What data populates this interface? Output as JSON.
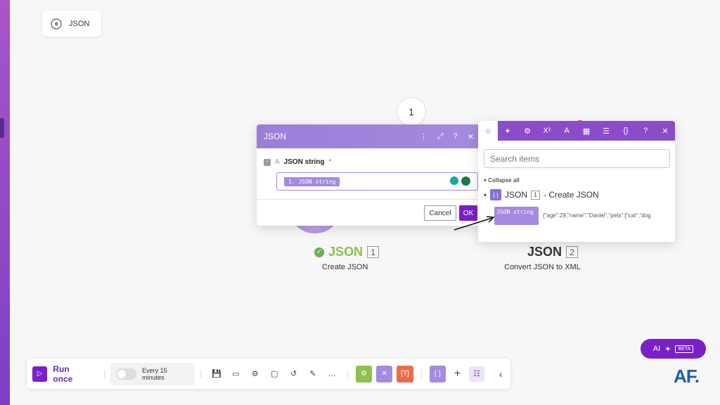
{
  "back": {
    "label": "JSON"
  },
  "route": {
    "number": "1"
  },
  "modules": [
    {
      "title": "JSON",
      "number": "1",
      "subtitle": "Create JSON",
      "color": "#8cc152"
    },
    {
      "title": "JSON",
      "number": "2",
      "subtitle": "Convert JSON to XML"
    }
  ],
  "json_panel": {
    "title": "JSON",
    "field_label": "JSON string",
    "required_mark": "*",
    "field_value": "1. JSON string",
    "cancel_label": "Cancel",
    "ok_label": "OK"
  },
  "map_panel": {
    "tabs": [
      "star-icon",
      "sparkle-icon",
      "gear-icon",
      "superscript-icon",
      "text-icon",
      "calendar-icon",
      "table-icon",
      "braces-icon",
      "help-icon",
      "close-icon"
    ],
    "search_placeholder": "Search items",
    "collapse_label": "Collapse all",
    "tree_module": "JSON",
    "tree_number": "1",
    "tree_suffix": "- Create JSON",
    "item_label": "JSON string",
    "item_value": "{\"age\":29,\"name\":\"Daniel\",\"pets\":[\"cat\",\"dog"
  },
  "toolbar": {
    "run_label": "Run once",
    "schedule_label": "Every 15 minutes"
  },
  "ai": {
    "label": "AI",
    "badge": "BETA"
  },
  "logo": "AF.",
  "colors": {
    "accent": "#7b1fc7",
    "panel_header": "#a48ae0",
    "success": "#6ab04c",
    "green_tool": "#8cc152",
    "purple_tool": "#a48ae0",
    "red_tool": "#f06a4a"
  }
}
